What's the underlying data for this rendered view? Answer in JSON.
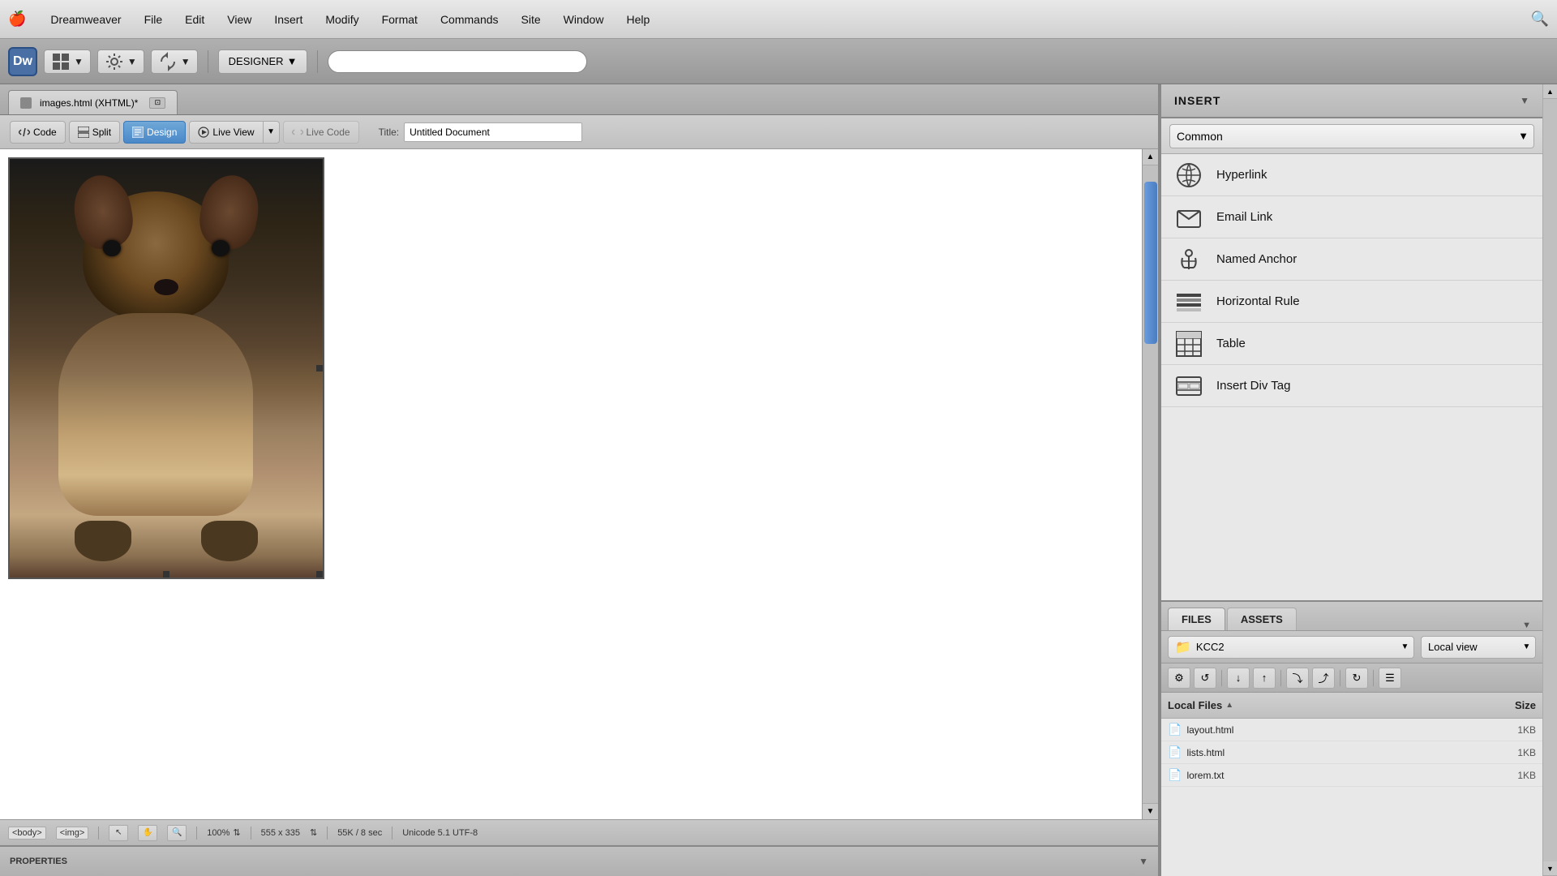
{
  "menubar": {
    "apple": "🍎",
    "items": [
      {
        "id": "dreamweaver",
        "label": "Dreamweaver"
      },
      {
        "id": "file",
        "label": "File"
      },
      {
        "id": "edit",
        "label": "Edit"
      },
      {
        "id": "view",
        "label": "View"
      },
      {
        "id": "insert",
        "label": "Insert"
      },
      {
        "id": "modify",
        "label": "Modify"
      },
      {
        "id": "format",
        "label": "Format"
      },
      {
        "id": "commands",
        "label": "Commands"
      },
      {
        "id": "site",
        "label": "Site"
      },
      {
        "id": "window",
        "label": "Window"
      },
      {
        "id": "help",
        "label": "Help"
      }
    ]
  },
  "toolbar": {
    "dw_logo": "Dw",
    "designer_label": "DESIGNER",
    "search_placeholder": ""
  },
  "doc_tab": {
    "filename": "images.html (XHTML)*",
    "expand_icon": "⊡"
  },
  "view_bar": {
    "code_btn": "Code",
    "split_btn": "Split",
    "design_btn": "Design",
    "live_view_btn": "Live View",
    "live_code_btn": "Live Code",
    "title_label": "Title:",
    "title_value": "Untitled Document"
  },
  "status_bar": {
    "tag1": "<body>",
    "tag2": "<img>",
    "zoom": "100%",
    "dimensions": "555 x 335",
    "file_info": "55K / 8 sec",
    "encoding": "Unicode 5.1 UTF-8"
  },
  "properties": {
    "label": "PROPERTIES"
  },
  "insert_panel": {
    "title": "INSERT",
    "dropdown_value": "Common",
    "items": [
      {
        "id": "hyperlink",
        "label": "Hyperlink",
        "icon": "hyperlink"
      },
      {
        "id": "email-link",
        "label": "Email Link",
        "icon": "email"
      },
      {
        "id": "named-anchor",
        "label": "Named Anchor",
        "icon": "anchor"
      },
      {
        "id": "horizontal-rule",
        "label": "Horizontal Rule",
        "icon": "hrule"
      },
      {
        "id": "table",
        "label": "Table",
        "icon": "table"
      },
      {
        "id": "insert-div-tag",
        "label": "Insert Div Tag",
        "icon": "div"
      }
    ]
  },
  "files_panel": {
    "tabs": [
      {
        "id": "files",
        "label": "FILES"
      },
      {
        "id": "assets",
        "label": "ASSETS"
      }
    ],
    "project_name": "KCC2",
    "view_label": "Local view",
    "columns": [
      {
        "id": "name",
        "label": "Local Files"
      },
      {
        "id": "size",
        "label": "Size"
      }
    ],
    "files": [
      {
        "id": "layout",
        "name": "layout.html",
        "size": "1KB"
      },
      {
        "id": "lists",
        "name": "lists.html",
        "size": "1KB"
      },
      {
        "id": "lorem",
        "name": "lorem.txt",
        "size": "1KB"
      }
    ]
  }
}
